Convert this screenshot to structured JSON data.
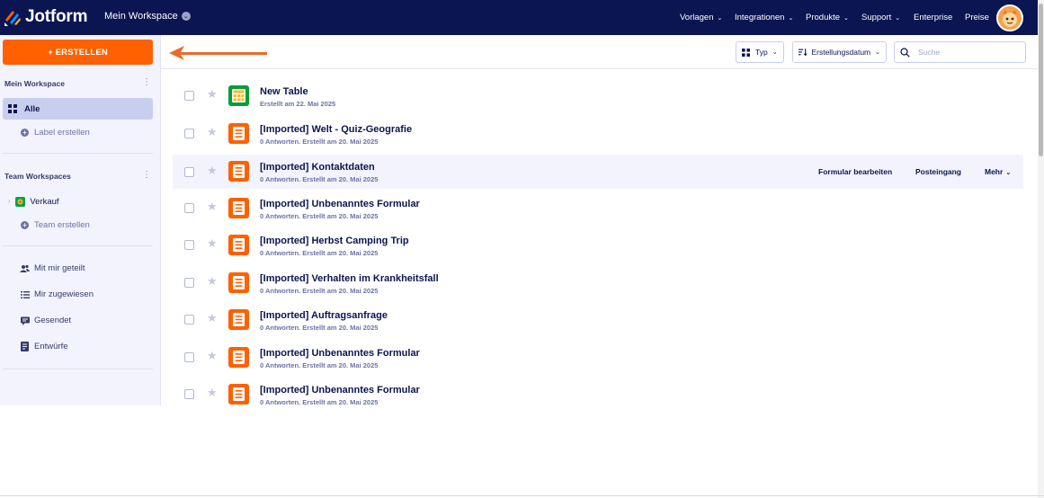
{
  "topbar": {
    "brand": "Jotform",
    "workspace_switch": "Mein Workspace",
    "nav": [
      {
        "label": "Vorlagen",
        "has_menu": true
      },
      {
        "label": "Integrationen",
        "has_menu": true
      },
      {
        "label": "Produkte",
        "has_menu": true
      },
      {
        "label": "Support",
        "has_menu": true
      },
      {
        "label": "Enterprise",
        "has_menu": false
      },
      {
        "label": "Preise",
        "has_menu": false
      }
    ],
    "avatar_icon": "cartoon-avatar-icon",
    "background_color": "#0a1551"
  },
  "sidebar": {
    "create_label": "+ ERSTELLEN",
    "create_color": "#ff6100",
    "my_workspace_heading": "Mein Workspace",
    "all_label": "Alle",
    "create_label_link": "Label erstellen",
    "team_heading": "Team Workspaces",
    "team_item": "Verkauf",
    "create_team": "Team erstellen",
    "links": [
      {
        "label": "Mit mir geteilt",
        "icon": "shared-users-icon"
      },
      {
        "label": "Mir zugewiesen",
        "icon": "assigned-list-icon"
      },
      {
        "label": "Gesendet",
        "icon": "sent-message-icon"
      },
      {
        "label": "Entwürfe",
        "icon": "draft-document-icon"
      }
    ]
  },
  "toolbar": {
    "type_filter": "Typ",
    "sort_label": "Erstellungsdatum",
    "search_placeholder": "Suche"
  },
  "forms": [
    {
      "title": "New Table",
      "subtitle": "Erstellt am 22. Mai 2025",
      "kind": "table"
    },
    {
      "title": "[Imported] Welt - Quiz-Geografie",
      "subtitle": "0 Antworten. Erstellt am 20. Mai 2025",
      "kind": "form"
    },
    {
      "title": "[Imported] Kontaktdaten",
      "subtitle": "0 Antworten. Erstellt am 20. Mai 2025",
      "kind": "form",
      "hovered": true
    },
    {
      "title": "[Imported] Unbenanntes Formular",
      "subtitle": "0 Antworten. Erstellt am 20. Mai 2025",
      "kind": "form"
    },
    {
      "title": "[Imported] Herbst Camping Trip",
      "subtitle": "0 Antworten. Erstellt am 20. Mai 2025",
      "kind": "form"
    },
    {
      "title": "[Imported] Verhalten im Krankheitsfall",
      "subtitle": "0 Antworten. Erstellt am 20. Mai 2025",
      "kind": "form"
    },
    {
      "title": "[Imported] Auftragsanfrage",
      "subtitle": "0 Antworten. Erstellt am 20. Mai 2025",
      "kind": "form"
    },
    {
      "title": "[Imported] Unbenanntes Formular",
      "subtitle": "0 Antworten. Erstellt am 20. Mai 2025",
      "kind": "form"
    },
    {
      "title": "[Imported] Unbenanntes Formular",
      "subtitle": "0 Antworten. Erstellt am 20. Mai 2025",
      "kind": "form"
    }
  ],
  "row_actions": {
    "edit": "Formular bearbeiten",
    "inbox": "Posteingang",
    "more": "Mehr"
  }
}
